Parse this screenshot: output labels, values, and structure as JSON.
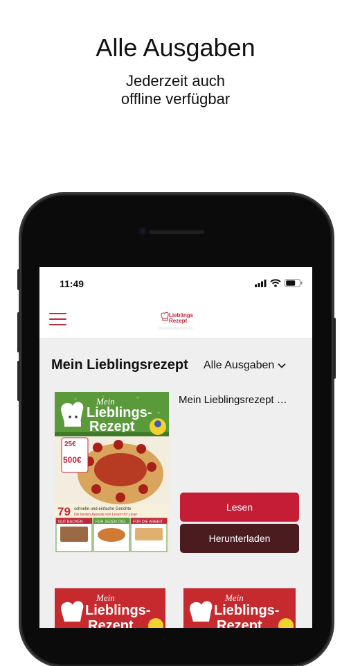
{
  "promo": {
    "title": "Alle Ausgaben",
    "subtitle_line1": "Jederzeit auch",
    "subtitle_line2": "offline verfügbar"
  },
  "status_bar": {
    "time": "11:49"
  },
  "app_bar": {
    "logo_line1": "Lieblings-",
    "logo_line2": "Rezept"
  },
  "main": {
    "section_title": "Mein Lieblingsrezept",
    "filter_label": "Alle Ausgaben",
    "issue": {
      "title": "Mein Lieblingsrezept …",
      "read_label": "Lesen",
      "download_label": "Herunterladen",
      "cover": {
        "brand_mein": "Mein",
        "brand_line1": "Lieblings-",
        "brand_line2": "Rezept",
        "price_badge": "25€",
        "prize": "500€",
        "count": "79",
        "count_text": "schnelle und einfache Gerichte",
        "count_sub": "Die besten Rezepte von Lesern für Leser",
        "boxes": [
          "GUT BACKEN",
          "FÜR JEDEN TAG",
          "FÜR DIE ARBEIT"
        ]
      }
    },
    "more_covers": [
      {
        "brand_mein": "Mein",
        "brand_line1": "Lieblings-",
        "brand_line2": "Rezept"
      },
      {
        "brand_mein": "Mein",
        "brand_line1": "Lieblings-",
        "brand_line2": "Rezept"
      }
    ]
  },
  "colors": {
    "accent": "#c51d36",
    "dark_button": "#4a1c20",
    "cover_green": "#5a9a3a",
    "cover_red": "#c62a2e"
  }
}
